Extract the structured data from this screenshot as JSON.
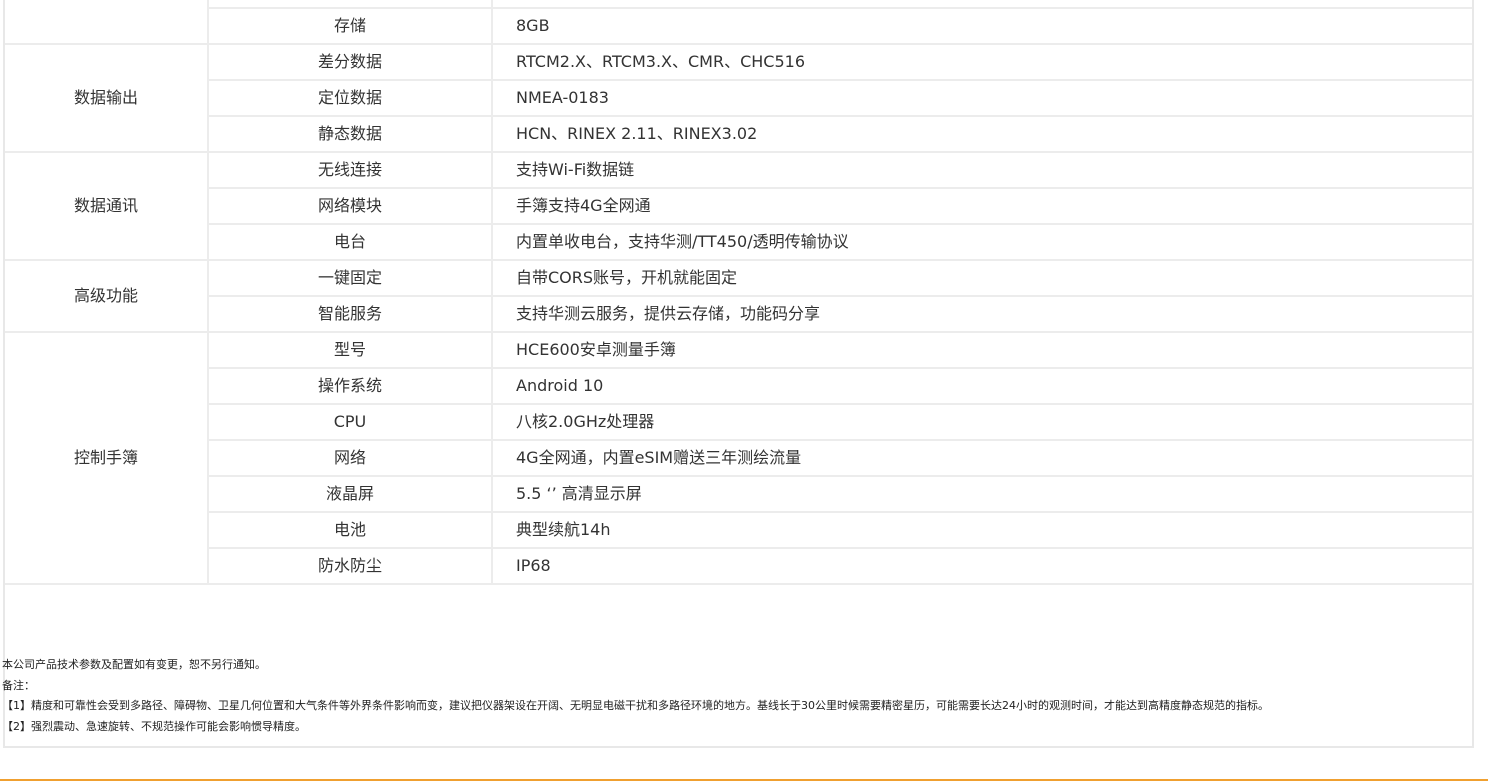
{
  "spec_table": {
    "rows": [
      {
        "group": "",
        "param": "",
        "value": ""
      },
      {
        "group": "",
        "param": "存储",
        "value": "8GB"
      },
      {
        "group": "数据输出",
        "param": "差分数据",
        "value": "RTCM2.X、RTCM3.X、CMR、CHC516"
      },
      {
        "group": "",
        "param": "定位数据",
        "value": "NMEA-0183"
      },
      {
        "group": "",
        "param": "静态数据",
        "value": "HCN、RINEX 2.11、RINEX3.02"
      },
      {
        "group": "数据通讯",
        "param": "无线连接",
        "value": "支持Wi-Fi数据链"
      },
      {
        "group": "",
        "param": "网络模块",
        "value": "手簿支持4G全网通"
      },
      {
        "group": "",
        "param": "电台",
        "value": "内置单收电台，支持华测/TT450/透明传输协议"
      },
      {
        "group": "高级功能",
        "param": "一键固定",
        "value": "自带CORS账号，开机就能固定"
      },
      {
        "group": "",
        "param": "智能服务",
        "value": "支持华测云服务，提供云存储，功能码分享"
      },
      {
        "group": "控制手簿",
        "param": "型号",
        "value": "HCE600安卓测量手簿"
      },
      {
        "group": "",
        "param": "操作系统",
        "value": "Android 10"
      },
      {
        "group": "",
        "param": "CPU",
        "value": "八核2.0GHz处理器"
      },
      {
        "group": "",
        "param": "网络",
        "value": "4G全网通，内置eSIM赠送三年测绘流量"
      },
      {
        "group": "",
        "param": "液晶屏",
        "value": "5.5 ‘’ 高清显示屏"
      },
      {
        "group": "",
        "param": "电池",
        "value": "典型续航14h"
      },
      {
        "group": "",
        "param": "防水防尘",
        "value": "IP68"
      }
    ]
  },
  "notes": {
    "disclaimer": "本公司产品技术参数及配置如有变更，恕不另行通知。",
    "heading": "备注：",
    "note1": "【1】精度和可靠性会受到多路径、障碍物、卫星几何位置和大气条件等外界条件影响而变，建议把仪器架设在开阔、无明显电磁干扰和多路径环境的地方。基线长于30公里时候需要精密星历，可能需要长达24小时的观测时间，才能达到高精度静态规范的指标。",
    "note2": "【2】强烈震动、急速旋转、不规范操作可能会影响惯导精度。"
  },
  "colors": {
    "border": "#ececec",
    "accent_bar": "#f0a030",
    "text": "#333333"
  }
}
